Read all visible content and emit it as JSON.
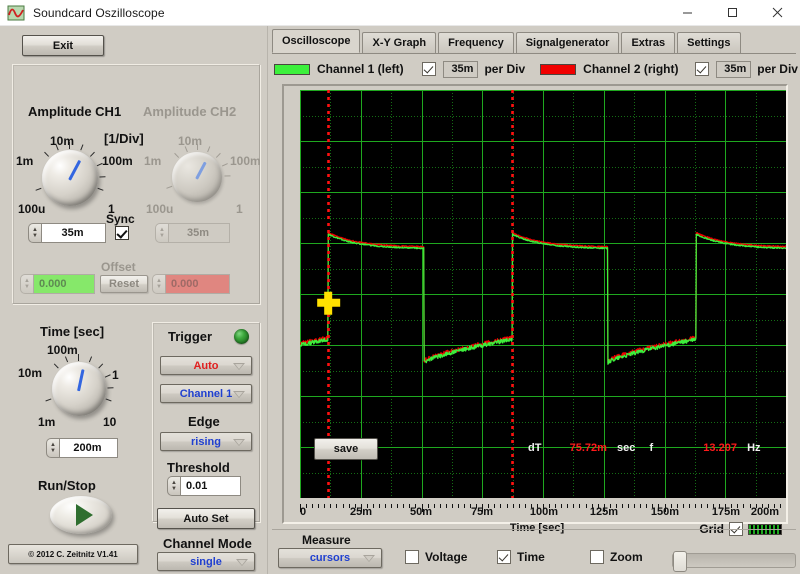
{
  "window": {
    "title": "Soundcard Oszilloscope",
    "icon": "oscilloscope-waveform-icon",
    "minimize": "–",
    "maximize": "☐",
    "close": "✕"
  },
  "left": {
    "exit_label": "Exit",
    "amplitude": {
      "ch1_title": "Amplitude CH1",
      "ch2_title": "Amplitude CH2",
      "per_div_title": "[1/Div]",
      "knob_ticks": [
        "1m",
        "10m",
        "100m",
        "1",
        "100u"
      ],
      "ch1_value": "35m",
      "ch2_value": "35m",
      "sync_label": "Sync",
      "sync_checked": true,
      "offset_label": "Offset",
      "offset_ch1": "0.000",
      "offset_ch2": "0.000",
      "reset_label": "Reset"
    },
    "time": {
      "title": "Time [sec]",
      "knob_ticks": [
        "10m",
        "100m",
        "1",
        "10",
        "1m"
      ],
      "value": "200m"
    },
    "runstop": {
      "label": "Run/Stop",
      "state": "running"
    },
    "trigger": {
      "title": "Trigger",
      "led_color": "#3ca83c",
      "mode": "Auto",
      "mode_color": "#e02020",
      "source": "Channel 1",
      "source_color": "#2040d0",
      "edge_label": "Edge",
      "edge": "rising",
      "edge_color": "#2040d0",
      "threshold_label": "Threshold",
      "threshold": "0.01",
      "autoset_label": "Auto Set"
    },
    "channel_mode": {
      "label": "Channel Mode",
      "value": "single",
      "value_color": "#2040d0"
    },
    "copyright": "© 2012  C. Zeitnitz V1.41"
  },
  "right": {
    "tabs": [
      {
        "label": "Oscilloscope",
        "active": true
      },
      {
        "label": "X-Y Graph",
        "active": false
      },
      {
        "label": "Frequency",
        "active": false
      },
      {
        "label": "Signalgenerator",
        "active": false
      },
      {
        "label": "Extras",
        "active": false
      },
      {
        "label": "Settings",
        "active": false
      }
    ],
    "channels": [
      {
        "name": "Channel 1 (left)",
        "color": "#3cf03c",
        "enabled": true,
        "per_div_value": "35m",
        "per_div_label": "per Div"
      },
      {
        "name": "Channel 2 (right)",
        "color": "#f00000",
        "enabled": true,
        "per_div_value": "35m",
        "per_div_label": "per Div"
      }
    ],
    "scope": {
      "save_label": "save",
      "grid_label": "Grid",
      "grid_checked": true,
      "grid_color": "#1fa81f",
      "cursor_color": "#ffe000",
      "cursor_line_color": "#ff1010",
      "readout": {
        "dt_label": "dT",
        "dt_value": "75.72m",
        "dt_unit": "sec",
        "f_label": "f",
        "f_value": "13.207",
        "f_unit": "Hz"
      }
    },
    "measure": {
      "title": "Measure",
      "mode": "cursors",
      "mode_color": "#2040d0",
      "options": [
        {
          "label": "Voltage",
          "checked": false
        },
        {
          "label": "Time",
          "checked": true
        },
        {
          "label": "Zoom",
          "checked": false
        }
      ]
    }
  },
  "chart_data": {
    "type": "line",
    "title": "Oscilloscope",
    "xlabel": "Time [sec]",
    "ylabel": "",
    "xlim": [
      0,
      0.2
    ],
    "ylim": [
      -0.14,
      0.14
    ],
    "grid": true,
    "x_ticks": [
      "0",
      "25m",
      "50m",
      "75m",
      "100m",
      "125m",
      "150m",
      "175m",
      "200m"
    ],
    "x_tick_values": [
      0,
      0.025,
      0.05,
      0.075,
      0.1,
      0.125,
      0.15,
      0.175,
      0.2
    ],
    "divisions_x": 8,
    "divisions_y": 8,
    "cursors": {
      "positions_sec": [
        0.0116,
        0.0873
      ],
      "dT_sec": 0.07572,
      "frequency_hz": 13.207,
      "marker_sec": 0.0116,
      "marker_value": -0.006
    },
    "series": [
      {
        "name": "Channel 1 (left)",
        "color": "#3cf03c",
        "waveform": "sawtooth-exponential-decay",
        "period_sec": 0.07572,
        "rise_time_sec": 0.0116,
        "peak_value": 0.041,
        "decay_to": 0.031,
        "trough_value": -0.047,
        "recover_to": -0.031
      },
      {
        "name": "Channel 2 (right)",
        "color": "#f00000",
        "waveform": "sawtooth-exponential-decay",
        "period_sec": 0.07572,
        "rise_time_sec": 0.0116,
        "peak_value": 0.042,
        "decay_to": 0.032,
        "trough_value": -0.046,
        "recover_to": -0.03
      }
    ]
  }
}
